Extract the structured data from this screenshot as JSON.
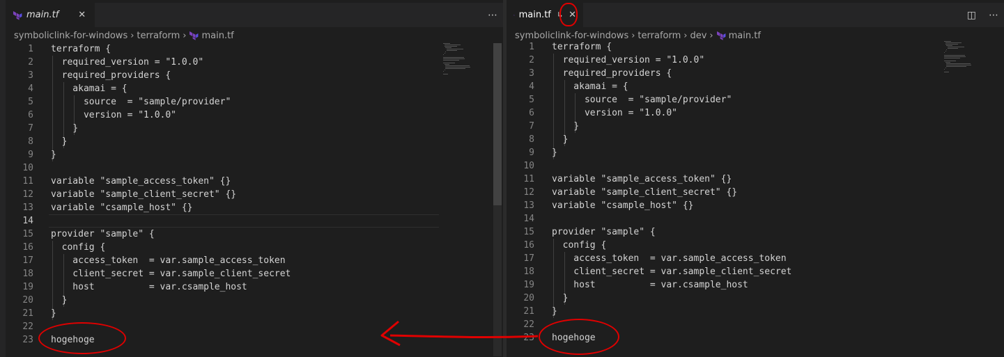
{
  "left_pane": {
    "tab_title": "main.tf",
    "breadcrumb": [
      "symboliclink-for-windows",
      "terraform",
      "main.tf"
    ],
    "current_line": 14
  },
  "right_pane": {
    "tab_title": "main.tf",
    "symlink_glyph": "↳",
    "breadcrumb": [
      "symboliclink-for-windows",
      "terraform",
      "dev",
      "main.tf"
    ]
  },
  "code_lines": [
    {
      "n": "1",
      "text": "terraform {"
    },
    {
      "n": "2",
      "text": "  required_version = \"1.0.0\""
    },
    {
      "n": "3",
      "text": "  required_providers {"
    },
    {
      "n": "4",
      "text": "    akamai = {"
    },
    {
      "n": "5",
      "text": "      source  = \"sample/provider\""
    },
    {
      "n": "6",
      "text": "      version = \"1.0.0\""
    },
    {
      "n": "7",
      "text": "    }"
    },
    {
      "n": "8",
      "text": "  }"
    },
    {
      "n": "9",
      "text": "}"
    },
    {
      "n": "10",
      "text": ""
    },
    {
      "n": "11",
      "text": "variable \"sample_access_token\" {}"
    },
    {
      "n": "12",
      "text": "variable \"sample_client_secret\" {}"
    },
    {
      "n": "13",
      "text": "variable \"csample_host\" {}"
    },
    {
      "n": "14",
      "text": ""
    },
    {
      "n": "15",
      "text": "provider \"sample\" {"
    },
    {
      "n": "16",
      "text": "  config {"
    },
    {
      "n": "17",
      "text": "    access_token  = var.sample_access_token"
    },
    {
      "n": "18",
      "text": "    client_secret = var.sample_client_secret"
    },
    {
      "n": "19",
      "text": "    host          = var.csample_host"
    },
    {
      "n": "20",
      "text": "  }"
    },
    {
      "n": "21",
      "text": "}"
    },
    {
      "n": "22",
      "text": ""
    },
    {
      "n": "23",
      "text": "hogehoge"
    }
  ],
  "icons": {
    "file_icon": "terraform-icon",
    "close": "close-icon",
    "more": "more-actions-icon",
    "split": "split-editor-icon",
    "symlink": "symlink-icon"
  },
  "colors": {
    "terraform_purple": "#7B42BC",
    "annotation_red": "#E00000",
    "editor_bg": "#1E1E1E"
  }
}
